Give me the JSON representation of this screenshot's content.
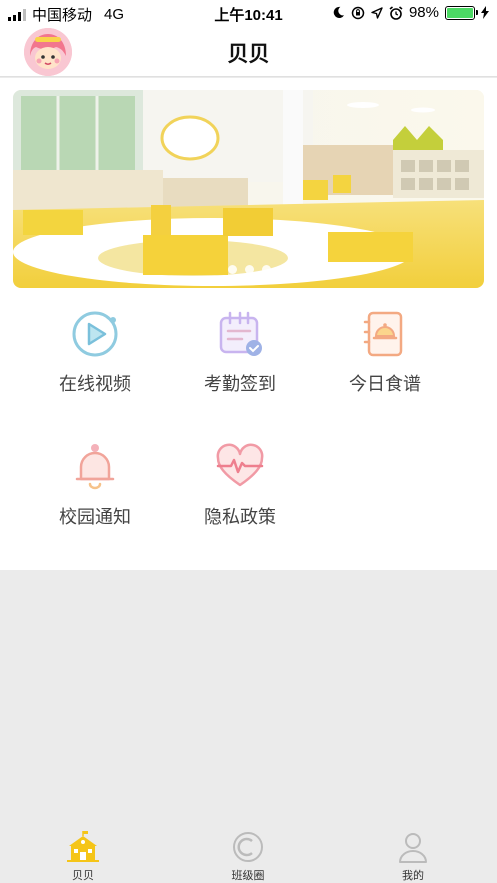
{
  "status": {
    "carrier": "中国移动",
    "network": "4G",
    "time": "上午10:41",
    "battery": "98%"
  },
  "header": {
    "title": "贝贝"
  },
  "menu": [
    {
      "label": "在线视频",
      "icon": "video-play-icon"
    },
    {
      "label": "考勤签到",
      "icon": "calendar-check-icon"
    },
    {
      "label": "今日食谱",
      "icon": "recipe-book-icon"
    },
    {
      "label": "校园通知",
      "icon": "bell-icon"
    },
    {
      "label": "隐私政策",
      "icon": "heart-pulse-icon"
    }
  ],
  "tabs": [
    {
      "label": "贝贝",
      "icon": "school-building-icon",
      "active": true
    },
    {
      "label": "班级圈",
      "icon": "circle-icon",
      "active": false
    },
    {
      "label": "我的",
      "icon": "user-icon",
      "active": false
    }
  ],
  "colors": {
    "accent": "#f5c518",
    "tab_inactive": "#bbbbbb"
  }
}
